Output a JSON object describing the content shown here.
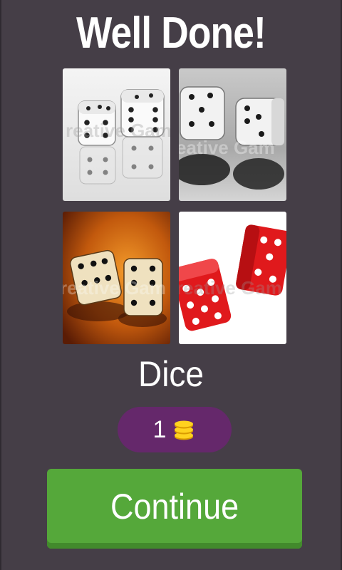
{
  "header": {
    "title": "Well Done!"
  },
  "puzzle": {
    "images": [
      {
        "label": "dice-image-1",
        "watermark": "reative Gam"
      },
      {
        "label": "dice-image-2",
        "watermark": "eative Gam"
      },
      {
        "label": "dice-image-3",
        "watermark": "reative Gam"
      },
      {
        "label": "dice-image-4",
        "watermark": "reative Gam"
      }
    ],
    "answer": "Dice"
  },
  "reward": {
    "count": "1",
    "icon": "coins-icon",
    "pill_color": "#65286b"
  },
  "actions": {
    "continue_label": "Continue",
    "button_color": "#55a83a"
  },
  "colors": {
    "background": "#453e47"
  }
}
